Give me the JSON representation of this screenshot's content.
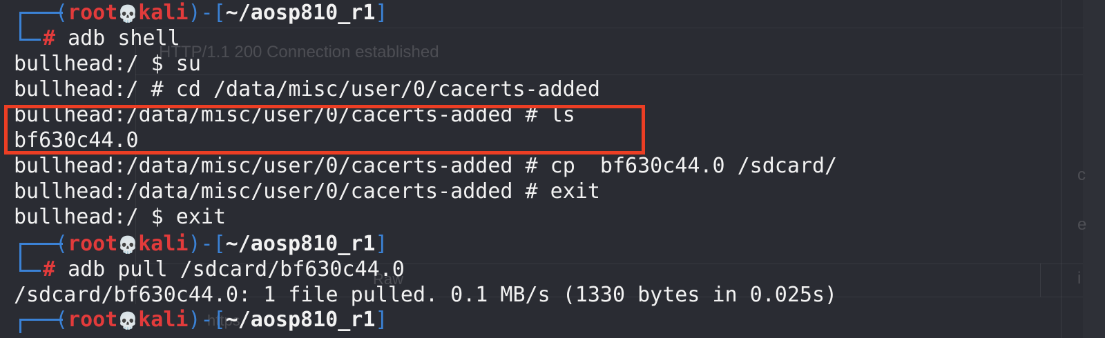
{
  "background_ghost": {
    "http_status": "HTTP/1.1 200 Connection established",
    "tab_raw": "Raw",
    "url_fragment": "https",
    "side_chars": [
      "c",
      "e",
      "i"
    ]
  },
  "colors": {
    "background": "#2a2c33",
    "prompt_blue": "#3b82d6",
    "prompt_red": "#e23b3b",
    "highlight_border": "#ec3e24"
  },
  "prompts": [
    {
      "open": "(",
      "user": "root",
      "skull": "💀",
      "host": "kali",
      "mid": ")-[",
      "path": "~/aosp810_r1",
      "close": "]",
      "hash": "#",
      "command": " adb shell"
    },
    {
      "open": "(",
      "user": "root",
      "skull": "💀",
      "host": "kali",
      "mid": ")-[",
      "path": "~/aosp810_r1",
      "close": "]",
      "hash": "#",
      "command": " adb pull /sdcard/bf630c44.0"
    },
    {
      "open": "(",
      "user": "root",
      "skull": "💀",
      "host": "kali",
      "mid": ")-[",
      "path": "~/aosp810_r1",
      "close": "]"
    }
  ],
  "lines": [
    "bullhead:/ $ su",
    "bullhead:/ # cd /data/misc/user/0/cacerts-added",
    "bullhead:/data/misc/user/0/cacerts-added # ls",
    "bf630c44.0",
    "bullhead:/data/misc/user/0/cacerts-added # cp  bf630c44.0 /sdcard/",
    "bullhead:/data/misc/user/0/cacerts-added # exit",
    "bullhead:/ $ exit",
    "/sdcard/bf630c44.0: 1 file pulled. 0.1 MB/s (1330 bytes in 0.025s)"
  ]
}
